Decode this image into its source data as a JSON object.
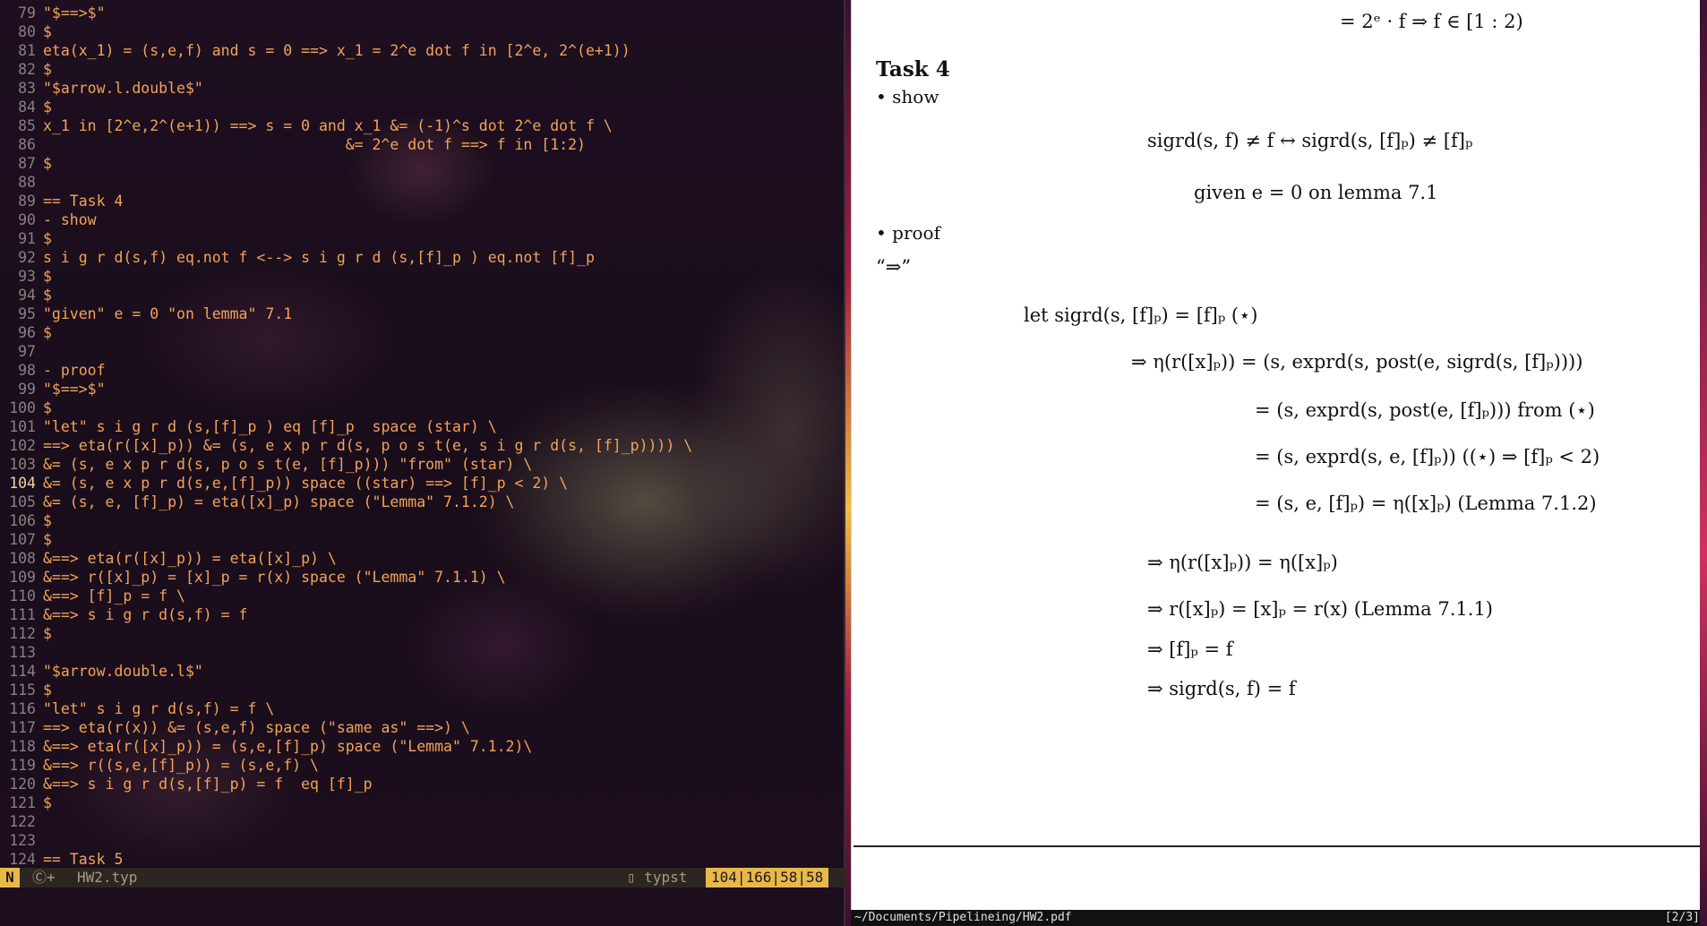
{
  "editor": {
    "lines": [
      {
        "n": "79",
        "text": "\"$==>$\""
      },
      {
        "n": "80",
        "text": "$"
      },
      {
        "n": "81",
        "text": "eta(x_1) = (s,e,f) and s = 0 ==> x_1 = 2^e dot f in [2^e, 2^(e+1))"
      },
      {
        "n": "82",
        "text": "$"
      },
      {
        "n": "83",
        "text": "\"$arrow.l.double$\""
      },
      {
        "n": "84",
        "text": "$"
      },
      {
        "n": "85",
        "text": "x_1 in [2^e,2^(e+1)) ==> s = 0 and x_1 &= (-1)^s dot 2^e dot f \\"
      },
      {
        "n": "86",
        "text": "                                  &= 2^e dot f ==> f in [1:2)"
      },
      {
        "n": "87",
        "text": "$"
      },
      {
        "n": "88",
        "text": ""
      },
      {
        "n": "89",
        "text": "== Task 4"
      },
      {
        "n": "90",
        "text": "- show"
      },
      {
        "n": "91",
        "text": "$"
      },
      {
        "n": "92",
        "text": "s i g r d(s,f) eq.not f <--> s i g r d (s,[f]_p ) eq.not [f]_p"
      },
      {
        "n": "93",
        "text": "$"
      },
      {
        "n": "94",
        "text": "$"
      },
      {
        "n": "95",
        "text": "\"given\" e = 0 \"on lemma\" 7.1"
      },
      {
        "n": "96",
        "text": "$"
      },
      {
        "n": "97",
        "text": ""
      },
      {
        "n": "98",
        "text": "- proof"
      },
      {
        "n": "99",
        "text": "\"$==>$\""
      },
      {
        "n": "100",
        "text": "$"
      },
      {
        "n": "101",
        "text": "\"let\" s i g r d (s,[f]_p ) eq [f]_p  space (star) \\"
      },
      {
        "n": "102",
        "text": "==> eta(r([x]_p)) &= (s, e x p r d(s, p o s t(e, s i g r d(s, [f]_p)))) \\"
      },
      {
        "n": "103",
        "text": "&= (s, e x p r d(s, p o s t(e, [f]_p))) \"from\" (star) \\"
      },
      {
        "n": "104",
        "text": "&= (s, e x p r d(s,e,[f]_p)) space ((star) ==> [f]_p < 2) \\"
      },
      {
        "n": "105",
        "text": "&= (s, e, [f]_p) = eta([x]_p) space (\"Lemma\" 7.1.2) \\"
      },
      {
        "n": "106",
        "text": "$"
      },
      {
        "n": "107",
        "text": "$"
      },
      {
        "n": "108",
        "text": "&==> eta(r([x]_p)) = eta([x]_p) \\"
      },
      {
        "n": "109",
        "text": "&==> r([x]_p) = [x]_p = r(x) space (\"Lemma\" 7.1.1) \\"
      },
      {
        "n": "110",
        "text": "&==> [f]_p = f \\"
      },
      {
        "n": "111",
        "text": "&==> s i g r d(s,f) = f"
      },
      {
        "n": "112",
        "text": "$"
      },
      {
        "n": "113",
        "text": ""
      },
      {
        "n": "114",
        "text": "\"$arrow.double.l$\""
      },
      {
        "n": "115",
        "text": "$"
      },
      {
        "n": "116",
        "text": "\"let\" s i g r d(s,f) = f \\"
      },
      {
        "n": "117",
        "text": "==> eta(r(x)) &= (s,e,f) space (\"same as\" ==>) \\"
      },
      {
        "n": "118",
        "text": "&==> eta(r([x]_p)) = (s,e,[f]_p) space (\"Lemma\" 7.1.2)\\"
      },
      {
        "n": "119",
        "text": "&==> r((s,e,[f]_p)) = (s,e,f) \\"
      },
      {
        "n": "120",
        "text": "&==> s i g r d(s,[f]_p) = f  eq [f]_p"
      },
      {
        "n": "121",
        "text": "$"
      },
      {
        "n": "122",
        "text": ""
      },
      {
        "n": "123",
        "text": ""
      },
      {
        "n": "124",
        "text": "== Task 5"
      }
    ],
    "current_line": "104",
    "status": {
      "mode": "N",
      "modified": "Ⓒ+",
      "filename": "HW2.typ",
      "filetype": "typst",
      "position": "104|166|58|58"
    }
  },
  "viewer": {
    "top_eq": "= 2ᵉ · f ⇒ f ∈ [1 : 2)",
    "heading": "Task 4",
    "bullet_show": "show",
    "show_eq": "sigrd(s, f) ≠ f ↔ sigrd(s, [f]ₚ) ≠ [f]ₚ",
    "given": "given e = 0 on lemma 7.1",
    "bullet_proof": "proof",
    "direction": "“⇒”",
    "proof_lines": [
      "let sigrd(s, [f]ₚ) = [f]ₚ (⋆)",
      "⇒ η(r([x]ₚ)) = (s, exprd(s, post(e, sigrd(s, [f]ₚ))))",
      "= (s, exprd(s, post(e, [f]ₚ))) from (⋆)",
      "= (s, exprd(s, e, [f]ₚ)) ((⋆) ⇒ [f]ₚ < 2)",
      "= (s, e, [f]ₚ) = η([x]ₚ) (Lemma 7.1.2)",
      "⇒ η(r([x]ₚ)) = η([x]ₚ)",
      "⇒ r([x]ₚ) = [x]ₚ = r(x) (Lemma 7.1.1)",
      "⇒ [f]ₚ = f",
      "⇒ sigrd(s, f) = f"
    ],
    "path": "~/Documents/Pipelineing/HW2.pdf",
    "page_indicator": "[2/3]"
  }
}
